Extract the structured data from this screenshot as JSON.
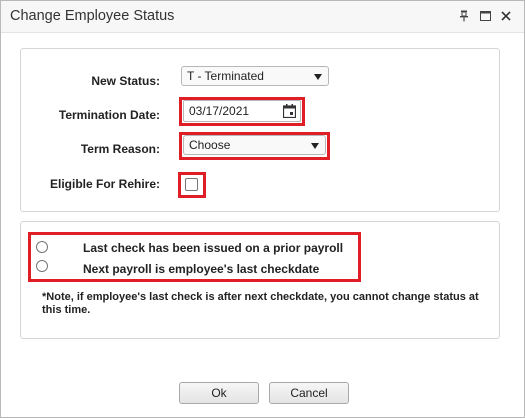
{
  "dialog": {
    "title": "Change Employee Status",
    "titlebar_icons": [
      "pin-icon",
      "maximize-icon",
      "close-icon"
    ]
  },
  "form": {
    "new_status": {
      "label": "New Status:",
      "value": "T - Terminated"
    },
    "termination_date": {
      "label": "Termination Date:",
      "value": "03/17/2021"
    },
    "term_reason": {
      "label": "Term Reason:",
      "value": "Choose"
    },
    "eligible_for_rehire": {
      "label": "Eligible For Rehire:",
      "checked": false
    }
  },
  "payroll": {
    "options": [
      {
        "label": "Last check has been issued on a prior payroll",
        "selected": false
      },
      {
        "label": "Next payroll is employee's last checkdate",
        "selected": false
      }
    ],
    "note": "*Note, if employee's last check is after next checkdate, you cannot change status at this time."
  },
  "buttons": {
    "ok": "Ok",
    "cancel": "Cancel"
  },
  "colors": {
    "highlight": "#e01e26",
    "titlebar": "#f7f7f7",
    "border": "#d6d6d6"
  }
}
